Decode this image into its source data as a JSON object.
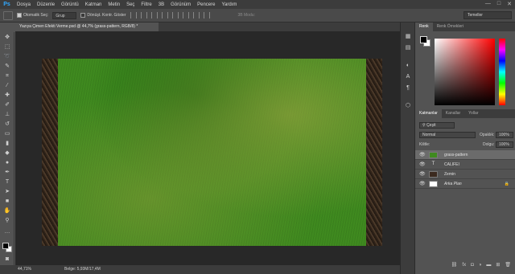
{
  "app": {
    "logo": "Ps"
  },
  "menu": [
    "Dosya",
    "Düzenle",
    "Görüntü",
    "Katman",
    "Metin",
    "Seç",
    "Filtre",
    "3B",
    "Görünüm",
    "Pencere",
    "Yardım"
  ],
  "window_controls": {
    "minimize": "—",
    "maximize": "□",
    "close": "✕"
  },
  "options": {
    "auto_select_label": "Otomatik Seç:",
    "auto_select_value": "Grup",
    "transform_label": "Dönüşt. Kontr. Göster",
    "mode3d_label": "3B Modu:",
    "workspace": "Temeller"
  },
  "document": {
    "tab_title": "Yazıya Çimen Efekti Verme.psd @ 44,7% (grass-pattern, RGB/8) *"
  },
  "statusbar": {
    "zoom": "44,71%",
    "doc_info": "Belge: 5,93M/17,4M"
  },
  "color_panel": {
    "tabs": [
      "Renk",
      "Renk Örnekleri"
    ],
    "colors": {
      "foreground": "#000000",
      "background": "#ffffff"
    }
  },
  "layers_panel": {
    "tabs": [
      "Katmanlar",
      "Kanallar",
      "Yollar"
    ],
    "filter_label": "Çeşit",
    "blend_mode": "Normal",
    "opacity_label": "Opaklık:",
    "opacity_value": "100%",
    "lock_label": "Kilitle:",
    "fill_label": "Dolgu:",
    "fill_value": "100%",
    "layers": [
      {
        "name": "grass-pattern",
        "selected": true
      },
      {
        "name": "CALIFEI",
        "selected": false
      },
      {
        "name": "Zemin",
        "selected": false
      },
      {
        "name": "Arka Plan",
        "selected": false
      }
    ]
  }
}
